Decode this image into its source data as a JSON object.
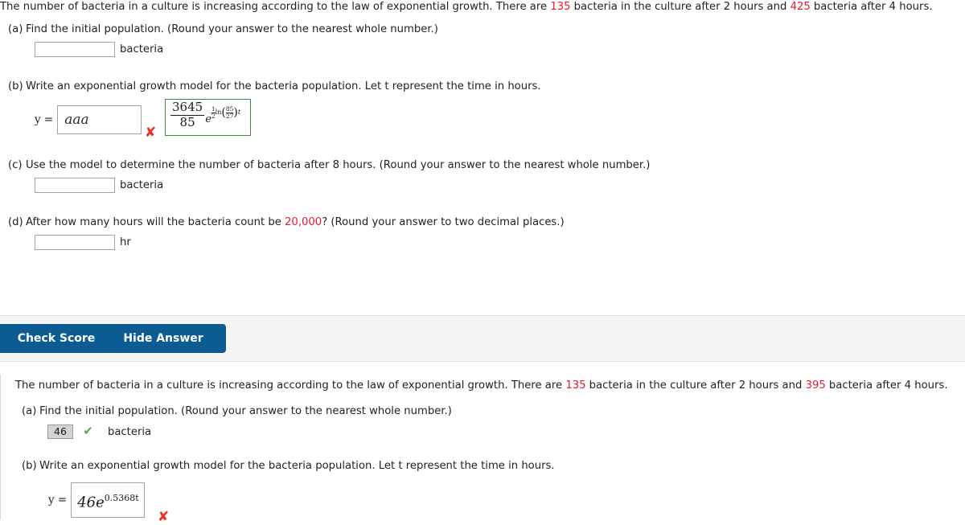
{
  "problem_one": {
    "stem": {
      "text_before_first": "The number of bacteria in a culture is increasing according to the law of exponential growth. There are ",
      "value_first": "135",
      "text_middle": " bacteria in the culture after 2 hours and ",
      "value_second": "425",
      "text_after": " bacteria after 4 hours."
    },
    "parts": [
      {
        "label": "(a)",
        "prompt": "Find the initial population. (Round your answer to the nearest whole number.)",
        "answer_value": "",
        "unit": "bacteria"
      },
      {
        "label": "(b)",
        "prompt": "Write an exponential growth model for the bacteria population. Let t represent the time in hours.",
        "equation_prefix": "y =",
        "answer_value": "aaa",
        "grade_icon": "wrong-answer-icon",
        "grade_mark": "✘",
        "correct_answer": {
          "numerator": "3645",
          "denominator": "85",
          "e_base": "e",
          "exp_coef_num": "1",
          "exp_coef_den": "2",
          "exp_ln": "ln",
          "exp_arg_num": "85",
          "exp_arg_den": "27",
          "exp_var": "t"
        }
      },
      {
        "label": "(c)",
        "prompt": "Use the model to determine the number of bacteria after 8 hours. (Round your answer to the nearest whole number.)",
        "answer_value": "",
        "unit": "bacteria"
      },
      {
        "label": "(d)",
        "prompt_before": "After how many hours will the bacteria count be ",
        "prompt_value": "20,000",
        "prompt_after": "? (Round your answer to two decimal places.)",
        "answer_value": "",
        "unit": "hr"
      }
    ]
  },
  "toolbar": {
    "check_score_label": "Check Score",
    "hide_answer_label": "Hide Answer",
    "button_color": "#0b5c92"
  },
  "problem_two": {
    "stem": {
      "text_before_first": "The number of bacteria in a culture is increasing according to the law of exponential growth. There are ",
      "value_first": "135",
      "text_middle": " bacteria in the culture after 2 hours and ",
      "value_second": "395",
      "text_after": " bacteria after 4 hours."
    },
    "parts": [
      {
        "label": "(a)",
        "prompt": "Find the initial population. (Round your answer to the nearest whole number.)",
        "answer_value": "46",
        "grade_icon": "correct-answer-icon",
        "grade_mark": "✔",
        "unit": "bacteria"
      },
      {
        "label": "(b)",
        "prompt": "Write an exponential growth model for the bacteria population. Let t represent the time in hours.",
        "equation_prefix": "y =",
        "answer_base": "46e",
        "answer_exponent": "0.5368t",
        "grade_icon": "wrong-answer-icon",
        "grade_mark": "✘"
      }
    ]
  },
  "colors": {
    "highlight_red": "#e8192c",
    "wrong_red": "#ee3124",
    "correct_green": "#4caf3f",
    "correct_box_border": "#3d8b3d",
    "button_blue": "#0b5c92",
    "band_gray": "#f5f5f5"
  }
}
